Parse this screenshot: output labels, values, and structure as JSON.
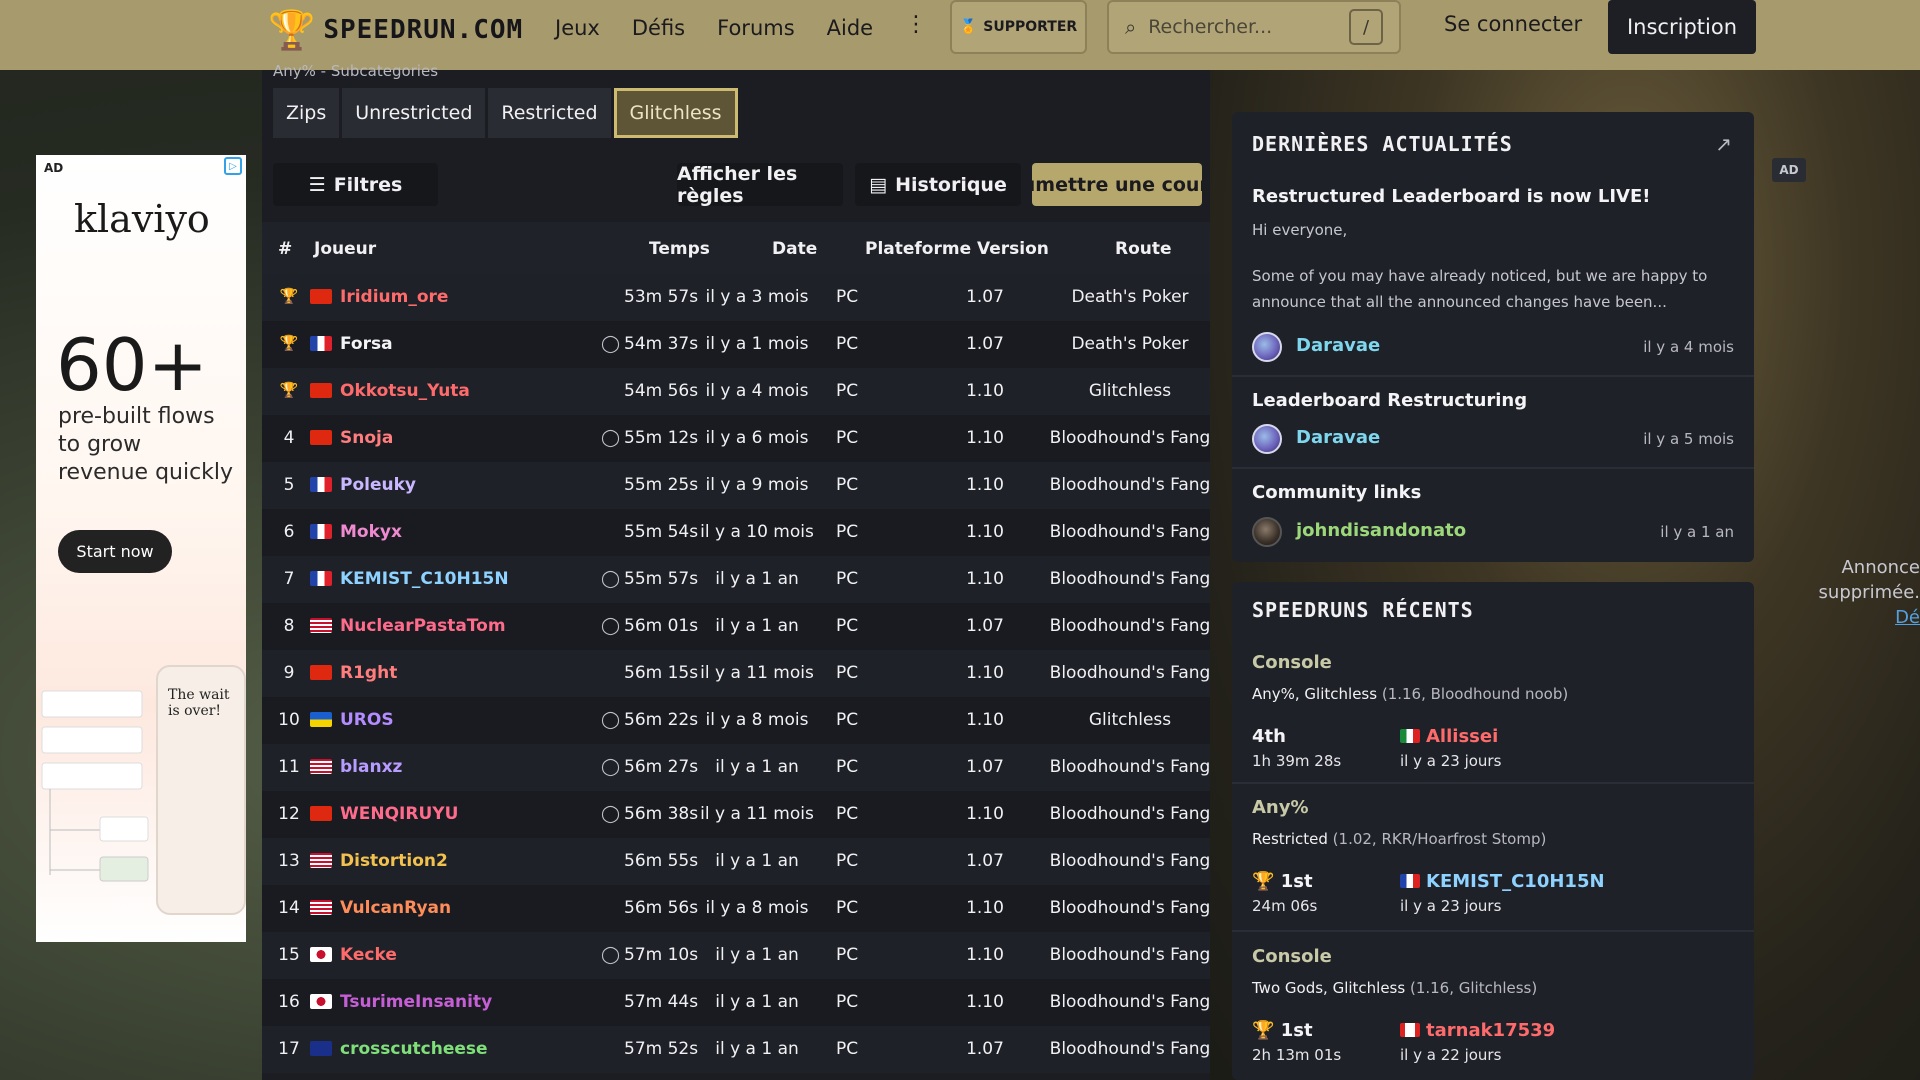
{
  "nav": {
    "logo_text": "SPEEDRUN.COM",
    "links": [
      "Jeux",
      "Défis",
      "Forums",
      "Aide"
    ],
    "more": "⋮",
    "supporter": "SUPPORTER",
    "search_placeholder": "Rechercher...",
    "search_shortcut": "/",
    "login": "Se connecter",
    "signup": "Inscription"
  },
  "leaderboard": {
    "subcategory_heading": "Any% - Subcategories",
    "subcategories": [
      "Zips",
      "Unrestricted",
      "Restricted",
      "Glitchless"
    ],
    "active_subcategory": "Glitchless",
    "filters": "Filtres",
    "show_rules": "Afficher les règles",
    "history": "Historique",
    "submit": "Soumettre une course",
    "columns": {
      "rank": "#",
      "player": "Joueur",
      "time": "Temps",
      "date": "Date",
      "platform": "Plateforme",
      "version": "Version",
      "route": "Route"
    },
    "rows": [
      {
        "rank": "🏆",
        "medal": "gold",
        "flag": "cn",
        "player": "Iridium_ore",
        "color": "#ff6b6b",
        "comment": false,
        "time": "53m 57s",
        "date": "il y a 3 mois",
        "platform": "PC",
        "version": "1.07",
        "route": "Death's Poker"
      },
      {
        "rank": "🏆",
        "medal": "silver",
        "flag": "fr",
        "player": "Forsa",
        "color": "#f4f4f6",
        "comment": true,
        "time": "54m 37s",
        "date": "il y a 1 mois",
        "platform": "PC",
        "version": "1.07",
        "route": "Death's Poker"
      },
      {
        "rank": "🏆",
        "medal": "bronze",
        "flag": "cn",
        "player": "Okkotsu_Yuta",
        "color": "#ff6b6b",
        "comment": false,
        "time": "54m 56s",
        "date": "il y a 4 mois",
        "platform": "PC",
        "version": "1.10",
        "route": "Glitchless"
      },
      {
        "rank": "4",
        "flag": "cn",
        "player": "Snoja",
        "color": "#ff7d7d",
        "comment": true,
        "time": "55m 12s",
        "date": "il y a 6 mois",
        "platform": "PC",
        "version": "1.10",
        "route": "Bloodhound's Fang"
      },
      {
        "rank": "5",
        "flag": "fr",
        "player": "Poleuky",
        "color": "#c9b8ff",
        "comment": false,
        "time": "55m 25s",
        "date": "il y a 9 mois",
        "platform": "PC",
        "version": "1.10",
        "route": "Bloodhound's Fang"
      },
      {
        "rank": "6",
        "flag": "fr",
        "player": "Mokyx",
        "color": "#f08ad0",
        "comment": false,
        "time": "55m 54s",
        "date": "il y a 10 mois",
        "platform": "PC",
        "version": "1.10",
        "route": "Bloodhound's Fang"
      },
      {
        "rank": "7",
        "flag": "fr",
        "player": "KEMIST_C10H15N",
        "color": "#8ed2ff",
        "comment": true,
        "time": "55m 57s",
        "date": "il y a 1 an",
        "platform": "PC",
        "version": "1.10",
        "route": "Bloodhound's Fang"
      },
      {
        "rank": "8",
        "flag": "us",
        "player": "NuclearPastaTom",
        "color": "#ff6b8b",
        "comment": true,
        "time": "56m 01s",
        "date": "il y a 1 an",
        "platform": "PC",
        "version": "1.07",
        "route": "Bloodhound's Fang"
      },
      {
        "rank": "9",
        "flag": "cn",
        "player": "R1ght",
        "color": "#ff7d7d",
        "comment": false,
        "time": "56m 15s",
        "date": "il y a 11 mois",
        "platform": "PC",
        "version": "1.10",
        "route": "Bloodhound's Fang"
      },
      {
        "rank": "10",
        "flag": "ua",
        "player": "UROS",
        "color": "#b48cff",
        "comment": true,
        "time": "56m 22s",
        "date": "il y a 8 mois",
        "platform": "PC",
        "version": "1.10",
        "route": "Glitchless"
      },
      {
        "rank": "11",
        "flag": "us",
        "player": "blanxz",
        "color": "#b89cff",
        "comment": true,
        "time": "56m 27s",
        "date": "il y a 1 an",
        "platform": "PC",
        "version": "1.07",
        "route": "Bloodhound's Fang"
      },
      {
        "rank": "12",
        "flag": "cn",
        "player": "WENQIRUYU",
        "color": "#ff6b8b",
        "comment": true,
        "time": "56m 38s",
        "date": "il y a 11 mois",
        "platform": "PC",
        "version": "1.10",
        "route": "Bloodhound's Fang"
      },
      {
        "rank": "13",
        "flag": "us",
        "player": "Distortion2",
        "color": "#f2c14e",
        "comment": false,
        "time": "56m 55s",
        "date": "il y a 1 an",
        "platform": "PC",
        "version": "1.07",
        "route": "Bloodhound's Fang"
      },
      {
        "rank": "14",
        "flag": "us",
        "player": "VulcanRyan",
        "color": "#ff8d5a",
        "comment": false,
        "time": "56m 56s",
        "date": "il y a 8 mois",
        "platform": "PC",
        "version": "1.10",
        "route": "Bloodhound's Fang"
      },
      {
        "rank": "15",
        "flag": "jp",
        "player": "Kecke",
        "color": "#ff6b6b",
        "comment": true,
        "time": "57m 10s",
        "date": "il y a 1 an",
        "platform": "PC",
        "version": "1.10",
        "route": "Bloodhound's Fang"
      },
      {
        "rank": "16",
        "flag": "jp",
        "player": "TsurimeInsanity",
        "color": "#c65fd6",
        "comment": false,
        "time": "57m 44s",
        "date": "il y a 1 an",
        "platform": "PC",
        "version": "1.10",
        "route": "Bloodhound's Fang"
      },
      {
        "rank": "17",
        "flag": "au",
        "player": "crosscutcheese",
        "color": "#7fe07a",
        "comment": false,
        "time": "57m 52s",
        "date": "il y a 1 an",
        "platform": "PC",
        "version": "1.07",
        "route": "Bloodhound's Fang"
      }
    ]
  },
  "ad_left": {
    "tag": "AD",
    "brand": "klaviyo",
    "headline": "60+",
    "subline": "pre-built flows to grow revenue quickly",
    "cta": "Start now",
    "mock_title": "The wait is over!"
  },
  "ad_right": {
    "tag": "AD",
    "line1": "Annonce",
    "line2": "supprimée.",
    "link": "Dé"
  },
  "news": {
    "heading": "DERNIÈRES ACTUALITÉS",
    "items": [
      {
        "title": "Restructured Leaderboard is now LIVE!",
        "greeting": "Hi everyone,",
        "excerpt": "Some of you may have already noticed, but we are happy to announce that all the announced changes have been...",
        "author": "Daravae",
        "time": "il y a 4 mois"
      },
      {
        "title": "Leaderboard Restructuring",
        "author": "Daravae",
        "time": "il y a 5 mois"
      },
      {
        "title": "Community links",
        "author": "johndisandonato",
        "time": "il y a 1 an"
      }
    ]
  },
  "recent": {
    "heading": "SPEEDRUNS RÉCENTS",
    "items": [
      {
        "platform": "Console",
        "category": "Any%, Glitchless",
        "detail": "(1.16, Bloodhound noob)",
        "place": "4th",
        "time": "1h 39m 28s",
        "runner": "Allissei",
        "runner_color": "#ff6b6b",
        "flag": "mx",
        "ago": "il y a 23 jours"
      },
      {
        "platform": "Any%",
        "category": "Restricted",
        "detail": "(1.02, RKR/Hoarfrost Stomp)",
        "place": "1st",
        "time": "24m 06s",
        "runner": "KEMIST_C10H15N",
        "runner_color": "#8ed2ff",
        "flag": "fr",
        "ago": "il y a 23 jours"
      },
      {
        "platform": "Console",
        "category": "Two Gods, Glitchless",
        "detail": "(1.16, Glitchless)",
        "place": "1st",
        "time": "2h 13m 01s",
        "runner": "tarnak17539",
        "runner_color": "#ff6b6b",
        "flag": "ca",
        "ago": "il y a 22 jours"
      }
    ]
  },
  "colors": {
    "accent": "#a79a6c",
    "panel": "#1f2129",
    "gold": "#e0a51c"
  }
}
